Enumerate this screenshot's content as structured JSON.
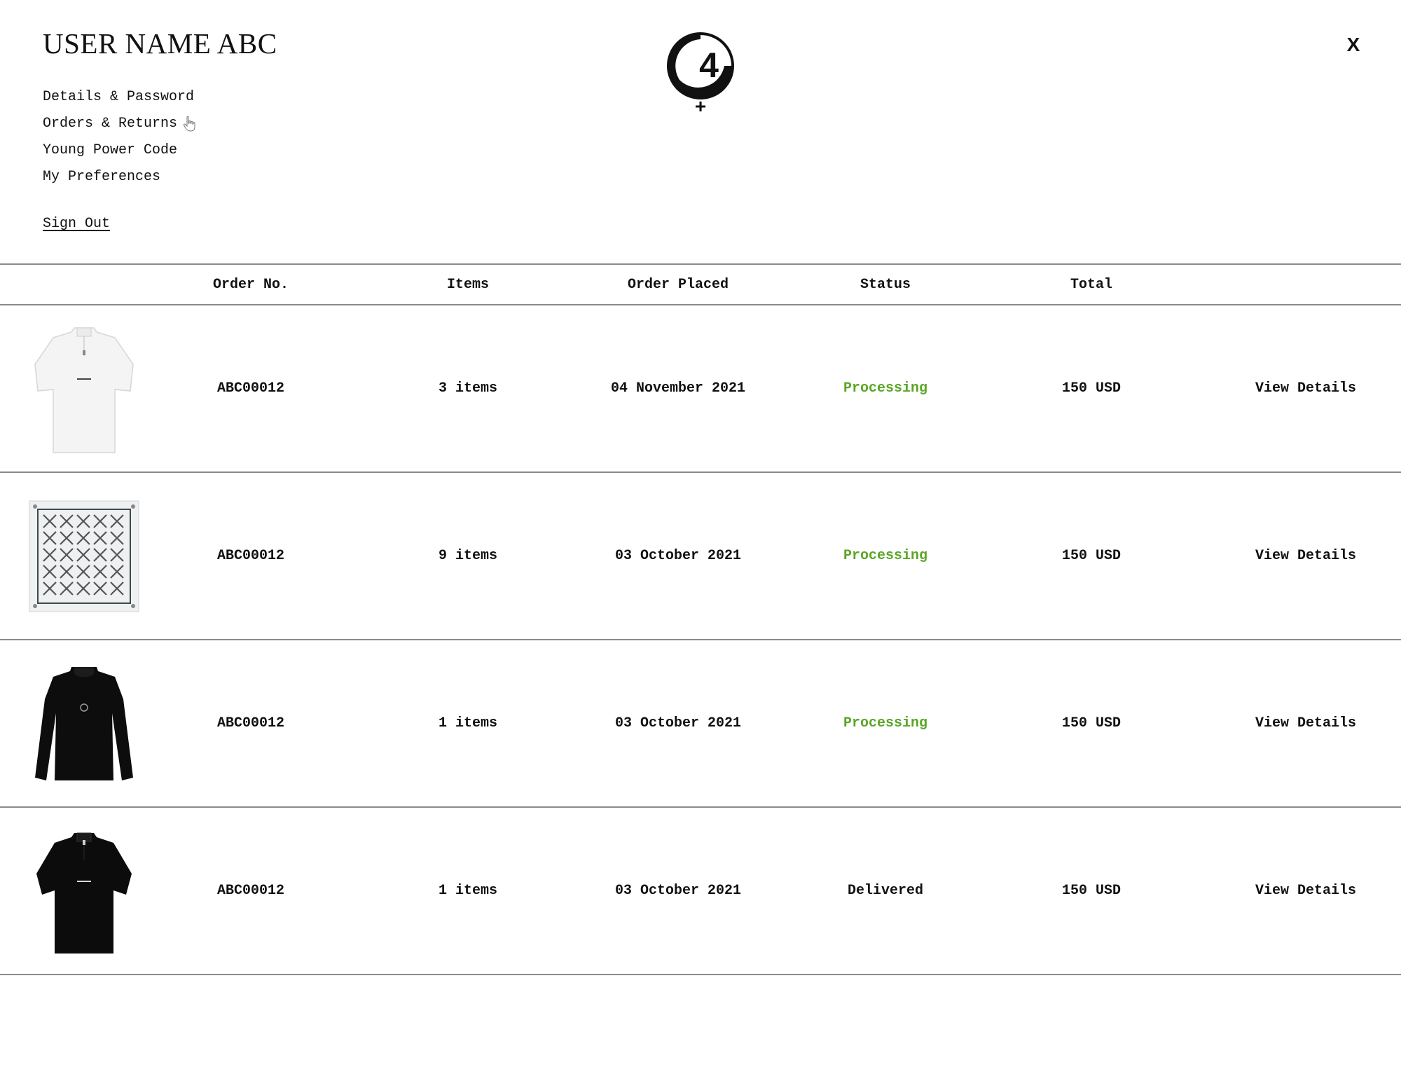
{
  "user": {
    "name": "USER NAME ABC"
  },
  "menu": {
    "items": [
      {
        "label": "Details & Password"
      },
      {
        "label": "Orders & Returns"
      },
      {
        "label": "Young Power Code"
      },
      {
        "label": "My Preferences"
      }
    ],
    "sign_out": "Sign Out"
  },
  "logo": {
    "symbol": "4",
    "plus": "+"
  },
  "close": {
    "label": "X"
  },
  "table": {
    "headers": {
      "order_no": "Order No.",
      "items": "Items",
      "placed": "Order Placed",
      "status": "Status",
      "total": "Total"
    },
    "rows": [
      {
        "image": "white-shirt",
        "order_no": "ABC00012",
        "items": "3 items",
        "placed": "04 November 2021",
        "status": "Processing",
        "total": "150 USD",
        "action": "View Details"
      },
      {
        "image": "patterned-scarf",
        "order_no": "ABC00012",
        "items": "9 items",
        "placed": "03 October 2021",
        "status": "Processing",
        "total": "150 USD",
        "action": "View Details"
      },
      {
        "image": "black-longsleeve",
        "order_no": "ABC00012",
        "items": "1 items",
        "placed": "03 October 2021",
        "status": "Processing",
        "total": "150 USD",
        "action": "View Details"
      },
      {
        "image": "black-shirt",
        "order_no": "ABC00012",
        "items": "1 items",
        "placed": "03 October 2021",
        "status": "Delivered",
        "total": "150 USD",
        "action": "View Details"
      }
    ]
  },
  "colors": {
    "processing": "#5aa626",
    "delivered": "#111111",
    "divider": "#8a8a8a"
  }
}
